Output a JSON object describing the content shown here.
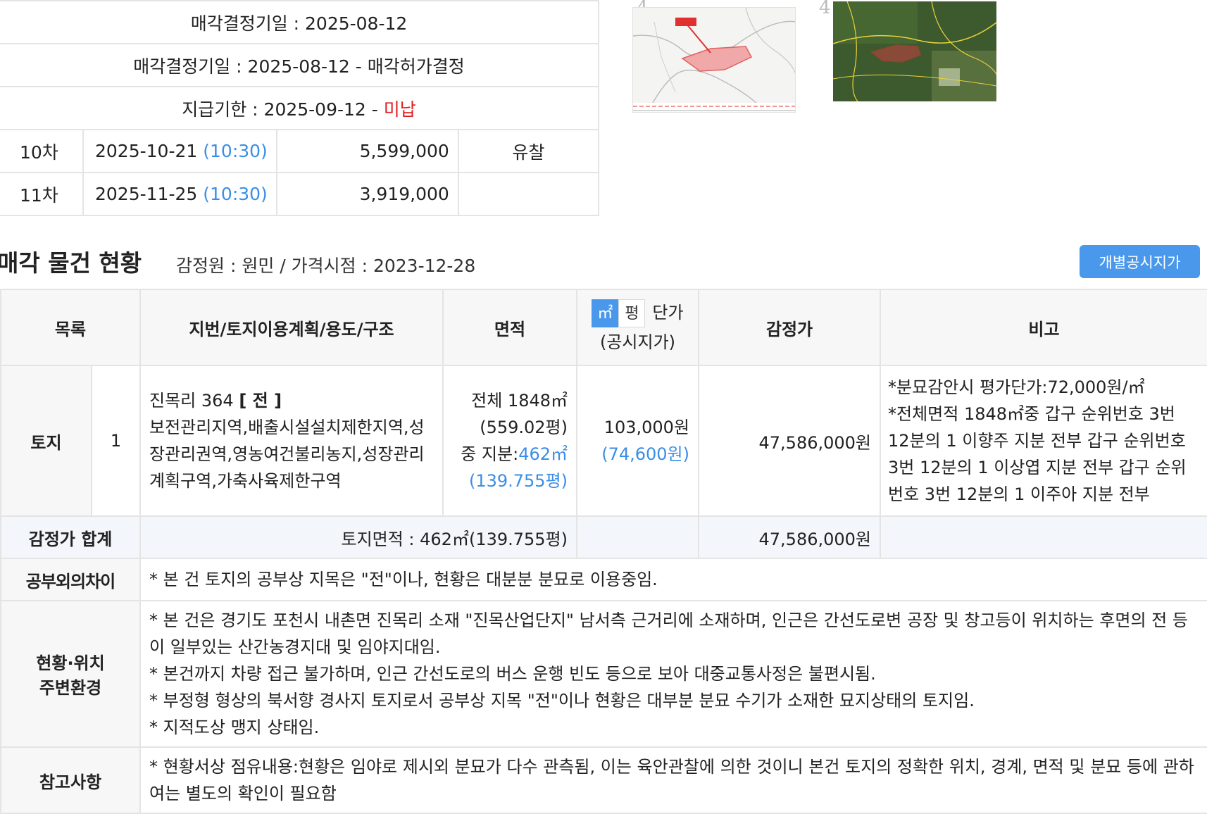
{
  "schedule": {
    "rows_full": [
      {
        "text": "매각결정기일 : 2025-08-12"
      },
      {
        "text": "매각결정기일 : 2025-08-12 - 매각허가결정"
      },
      {
        "prefix": "지급기한 : 2025-09-12 - ",
        "status": "미납"
      }
    ],
    "rounds": [
      {
        "round": "10차",
        "date": "2025-10-21",
        "time": "(10:30)",
        "price": "5,599,000",
        "result": "유찰"
      },
      {
        "round": "11차",
        "date": "2025-11-25",
        "time": "(10:30)",
        "price": "3,919,000",
        "result": ""
      }
    ]
  },
  "thumbnails": [
    {
      "number": "4",
      "icon": "cadastral-map-thumbnail"
    },
    {
      "number": "4",
      "icon": "aerial-photo-thumbnail"
    }
  ],
  "section": {
    "title": "매각 물건 현황",
    "subtitle": "감정원 : 원민 / 가격시점 : 2023-12-28",
    "gongsi_button": "개별공시지가"
  },
  "table": {
    "headers": {
      "category": "목록",
      "address": "지번/토지이용계획/용도/구조",
      "area": "면적",
      "unit_m2": "㎡",
      "unit_pyeong": "평",
      "unit_price_label": "단가",
      "unit_price_sub": "(공시지가)",
      "appraisal": "감정가",
      "remarks": "비고"
    },
    "item": {
      "category": "토지",
      "no": "1",
      "lot": "진목리 364",
      "land_type": "[ 전 ]",
      "zoning": "보전관리지역,배출시설설치제한지역,성장관리권역,영농여건불리농지,성장관리계획구역,가축사육제한구역",
      "area_total": "전체 1848㎡",
      "area_total_pyeong": "(559.02평)",
      "area_share_prefix": "중 지분:",
      "area_share": "462㎡",
      "area_share_pyeong": "(139.755평)",
      "unit_price": "103,000원",
      "gongsi_price": "(74,600원)",
      "appraisal": "47,586,000원",
      "remarks": [
        "*분묘감안시 평가단가:72,000원/㎡",
        "*전체면적 1848㎡중 갑구 순위번호 3번 12분의 1 이향주 지분 전부 갑구 순위번호 3번 12분의 1 이상엽 지분 전부 갑구 순위번호 3번 12분의 1 이주아 지분 전부"
      ]
    },
    "total": {
      "label": "감정가 합계",
      "land_area": "토지면적 : 462㎡(139.755평)",
      "appraisal": "47,586,000원"
    },
    "diff": {
      "label": "공부외의차이",
      "text": "* 본 건 토지의 공부상 지목은 \"전\"이나, 현황은 대분분 분묘로 이용중임."
    },
    "location": {
      "label_line1": "현황·위치",
      "label_line2": "주변환경",
      "lines": [
        "* 본 건은 경기도 포천시 내촌면 진목리 소재 \"진목산업단지\" 남서측 근거리에 소재하며, 인근은 간선도로변 공장 및 창고등이 위치하는 후면의 전 등이 일부있는 산간농경지대 및 임야지대임.",
        "* 본건까지 차량 접근 불가하며, 인근 간선도로의 버스 운행 빈도 등으로 보아 대중교통사정은 불편시됨.",
        "* 부정형 형상의 북서향 경사지 토지로서 공부상 지목 \"전\"이나 현황은 대부분 분묘 수기가 소재한 묘지상태의 토지임.",
        "* 지적도상 맹지 상태임."
      ]
    },
    "reference": {
      "label": "참고사항",
      "text": "* 현황서상 점유내용:현황은 임야로 제시외 분묘가 다수 관측됨, 이는 육안관찰에 의한 것이니 본건 토지의 정확한 위치, 경계, 면적 및 분묘 등에 관하여는 별도의 확인이 필요함"
    }
  }
}
